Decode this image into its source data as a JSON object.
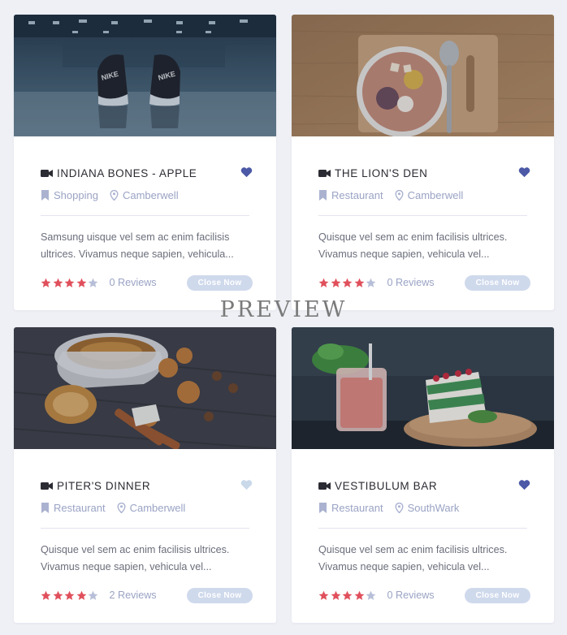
{
  "colors": {
    "accent": "#4b59a6",
    "heart_active": "#4b59a6",
    "heart_inactive": "#c9d9ea",
    "star_filled": "#e0505c",
    "star_empty": "#b7bfd8",
    "meta_text": "#9aa3c4",
    "button_bg": "#cfd9ec"
  },
  "listings": [
    {
      "title": "Indiana Bones - Apple",
      "favorited": true,
      "category": "Shopping",
      "location": "Camberwell",
      "description": "Samsung uisque vel sem ac enim facilisis ultrices. Vivamus neque sapien, vehicula...",
      "rating": 4,
      "reviews": "0 Reviews",
      "button": "Close Now",
      "image": "sneakers-gym-photo"
    },
    {
      "title": "The Lion's Den",
      "favorited": true,
      "category": "Restaurant",
      "location": "Camberwell",
      "description": "Quisque vel sem ac enim facilisis ultrices. Vivamus neque sapien, vehicula vel...",
      "rating": 4,
      "reviews": "0 Reviews",
      "button": "Close Now",
      "image": "smoothie-bowl-photo"
    },
    {
      "title": "Piter's Dinner",
      "favorited": false,
      "category": "Restaurant",
      "location": "Camberwell",
      "description": "Quisque vel sem ac enim facilisis ultrices. Vivamus neque sapien, vehicula vel...",
      "rating": 4,
      "reviews": "2 Reviews",
      "button": "Close Now",
      "image": "coffee-cookies-photo"
    },
    {
      "title": "Vestibulum Bar",
      "favorited": true,
      "category": "Restaurant",
      "location": "SouthWark",
      "description": "Quisque vel sem ac enim facilisis ultrices. Vivamus neque sapien, vehicula vel...",
      "rating": 4,
      "reviews": "0 Reviews",
      "button": "Close Now",
      "image": "drink-cake-photo"
    }
  ],
  "watermark": "PREVIEW"
}
